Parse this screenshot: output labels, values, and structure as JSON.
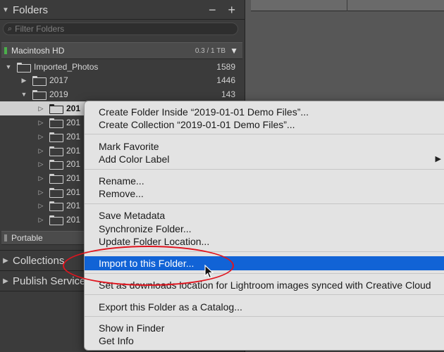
{
  "folders_panel": {
    "title": "Folders",
    "controls": "− +",
    "filter_placeholder": "Filter Folders"
  },
  "volume": {
    "name": "Macintosh HD",
    "capacity": "0.3 / 1 TB"
  },
  "tree": [
    {
      "label": "Imported_Photos",
      "count": "1589",
      "level": 0,
      "expanded": true
    },
    {
      "label": "2017",
      "count": "1446",
      "level": 1,
      "expanded": false
    },
    {
      "label": "2019",
      "count": "143",
      "level": 1,
      "expanded": true
    },
    {
      "label": "201",
      "level": 2,
      "selected": true
    },
    {
      "label": "201",
      "level": 2
    },
    {
      "label": "201",
      "level": 2
    },
    {
      "label": "201",
      "level": 2
    },
    {
      "label": "201",
      "level": 2
    },
    {
      "label": "201",
      "level": 2
    },
    {
      "label": "201",
      "level": 2
    },
    {
      "label": "201",
      "level": 2
    },
    {
      "label": "201",
      "level": 2
    }
  ],
  "portable": {
    "name": "Portable"
  },
  "panels": {
    "collections": "Collections",
    "publish_services": "Publish Services"
  },
  "context_menu": {
    "create_folder": "Create Folder Inside “2019-01-01 Demo Files”...",
    "create_collection": "Create Collection “2019-01-01 Demo Files”...",
    "mark_favorite": "Mark Favorite",
    "add_color_label": "Add Color Label",
    "rename": "Rename...",
    "remove": "Remove...",
    "save_metadata": "Save Metadata",
    "synchronize": "Synchronize Folder...",
    "update_location": "Update Folder Location...",
    "import": "Import to this Folder...",
    "set_downloads": "Set as downloads location for Lightroom images synced with Creative Cloud",
    "export_catalog": "Export this Folder as a Catalog...",
    "show_finder": "Show in Finder",
    "get_info": "Get Info"
  },
  "colors": {
    "highlight": "#1163d6",
    "annotation": "#e0141e",
    "volume_led": "#4bb04b"
  }
}
